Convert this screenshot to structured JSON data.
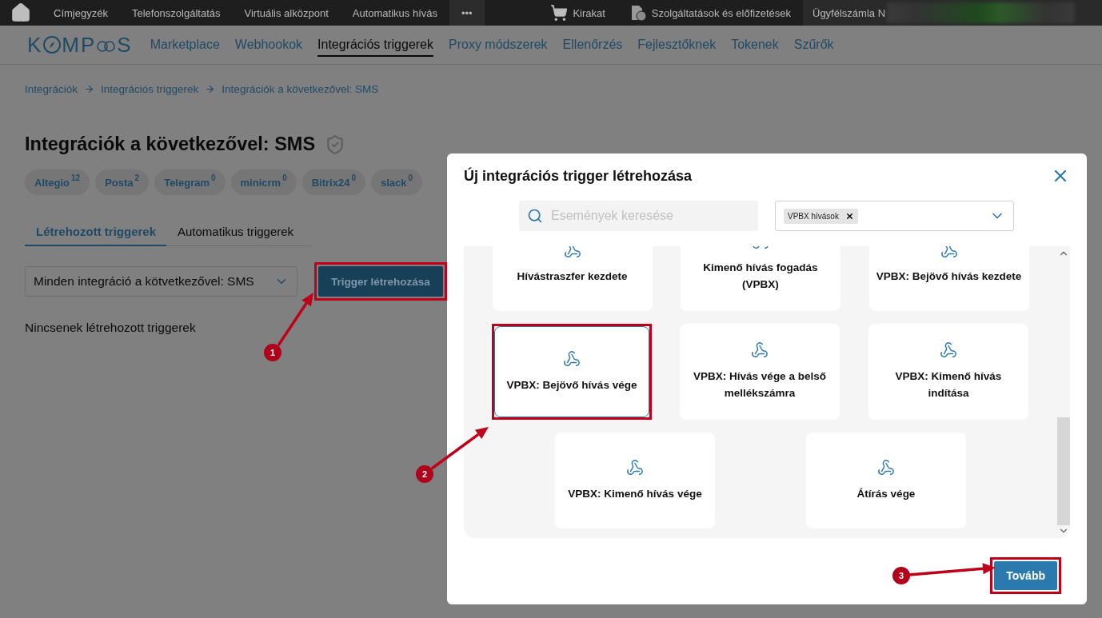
{
  "top_bar": {
    "items": [
      {
        "label": "Címjegyzék",
        "selected": false
      },
      {
        "label": "Telefonszolgáltatás",
        "selected": false
      },
      {
        "label": "Virtuális alközpont",
        "selected": false
      },
      {
        "label": "Automatikus hívás",
        "selected": false
      },
      {
        "label": "•••",
        "selected": true
      }
    ],
    "right_items": [
      {
        "kind": "cart",
        "label": "Kirakat"
      },
      {
        "kind": "document",
        "label": "Szolgáltatások és előfizetések"
      }
    ],
    "account": {
      "label": "Ügyfélszámla N"
    }
  },
  "nav": {
    "logo": [
      "K",
      "MP",
      "S"
    ],
    "items": [
      {
        "label": "Marketplace",
        "selected": false
      },
      {
        "label": "Webhookok",
        "selected": false
      },
      {
        "label": "Integrációs triggerek",
        "selected": true
      },
      {
        "label": "Proxy módszerek",
        "selected": false
      },
      {
        "label": "Ellenőrzés",
        "selected": false
      },
      {
        "label": "Fejlesztőknek",
        "selected": false
      },
      {
        "label": "Tokenek",
        "selected": false
      },
      {
        "label": "Szűrők",
        "selected": false
      }
    ]
  },
  "breadcrumb": [
    "Integrációk",
    "Integrációs triggerek",
    "Integrációk a következővel: SMS"
  ],
  "title": "Integrációk a következővel: SMS",
  "chips": [
    {
      "label": "Altegio",
      "count": "12"
    },
    {
      "label": "Posta",
      "count": "2"
    },
    {
      "label": "Telegram",
      "count": "0"
    },
    {
      "label": "minicrm",
      "count": "0"
    },
    {
      "label": "Bitrix24",
      "count": "0"
    },
    {
      "label": "slack",
      "count": "0"
    }
  ],
  "tabs": [
    {
      "label": "Létrehozott triggerek",
      "selected": true
    },
    {
      "label": "Automatikus triggerek",
      "selected": false
    }
  ],
  "filter_select": {
    "value": "Minden integráció a kötvetkezővel: SMS"
  },
  "create_button": {
    "label": "Trigger létrehozása",
    "highlighted": true
  },
  "empty_text": "Nincsenek létrehozott triggerek",
  "modal": {
    "title": "Új integrációs trigger létrehozása",
    "search": {
      "placeholder": "Események keresése"
    },
    "category_select": {
      "tags": [
        "VPBX hívások"
      ]
    },
    "cards": [
      {
        "label": "Hívástraszfer kezdete",
        "selected": false,
        "highlighted": false
      },
      {
        "label": "Kimenő hívás fogadás (VPBX)",
        "selected": false,
        "highlighted": false
      },
      {
        "label": "VPBX: Bejövő hívás kezdete",
        "selected": false,
        "highlighted": false
      },
      {
        "label": "VPBX: Bejövő hívás vége",
        "selected": true,
        "highlighted": true
      },
      {
        "label": "VPBX: Hívás vége a belső mellékszámra",
        "selected": false,
        "highlighted": false
      },
      {
        "label": "VPBX: Kimenő hívás indítása",
        "selected": false,
        "highlighted": false
      },
      {
        "label": "VPBX: Kimenő hívás vége",
        "selected": false,
        "highlighted": false
      },
      {
        "label": "Átírás vége",
        "selected": false,
        "highlighted": false
      }
    ],
    "next_button": {
      "label": "Tovább",
      "highlighted": true
    }
  },
  "annotations": [
    {
      "number": "1"
    },
    {
      "number": "2"
    },
    {
      "number": "3"
    }
  ]
}
